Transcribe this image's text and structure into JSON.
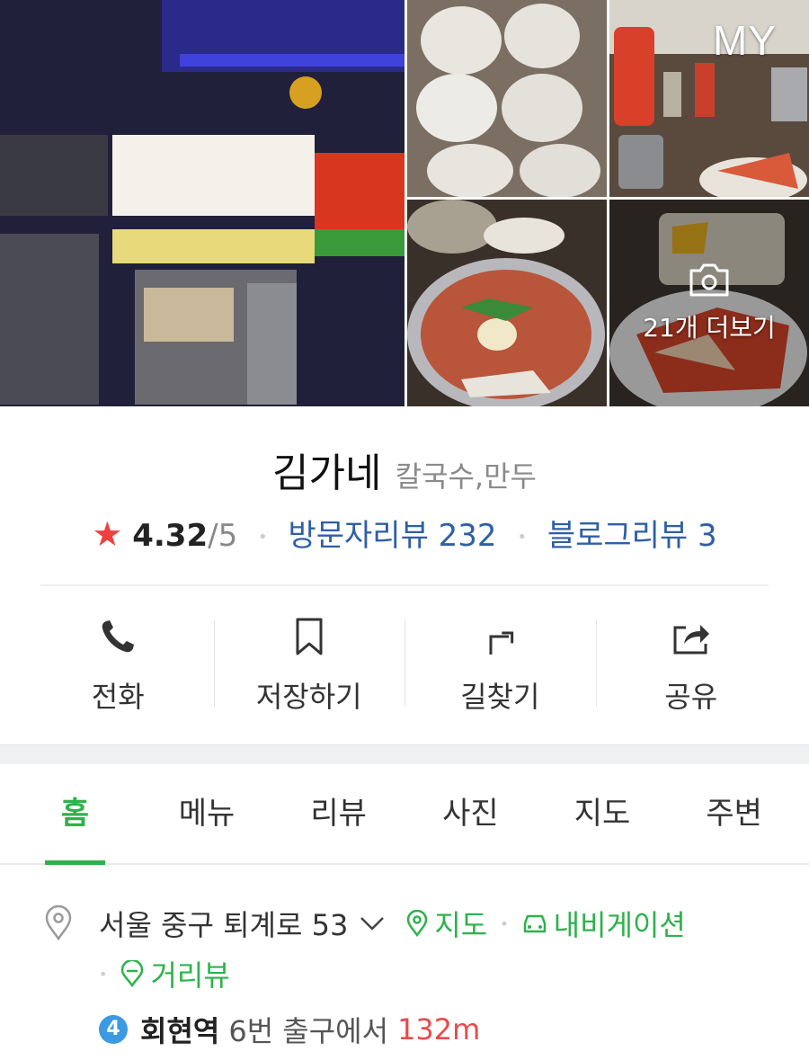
{
  "photos": {
    "my_label": "MY",
    "more_label": "21개 더보기"
  },
  "place": {
    "name": "김가네",
    "category": "칼국수,만두",
    "rating": "4.32",
    "rating_max": "/5",
    "visitor_review": "방문자리뷰 232",
    "blog_review": "블로그리뷰 3"
  },
  "actions": [
    {
      "label": "전화",
      "icon": "phone-icon"
    },
    {
      "label": "저장하기",
      "icon": "bookmark-icon"
    },
    {
      "label": "길찾기",
      "icon": "directions-icon"
    },
    {
      "label": "공유",
      "icon": "share-icon"
    }
  ],
  "tabs": [
    {
      "label": "홈",
      "active": true
    },
    {
      "label": "메뉴"
    },
    {
      "label": "리뷰"
    },
    {
      "label": "사진"
    },
    {
      "label": "지도"
    },
    {
      "label": "주변"
    }
  ],
  "address": {
    "text": "서울 중구 퇴계로 53",
    "map_link": "지도",
    "nav_link": "내비게이션",
    "street_view": "거리뷰",
    "subway_line": "4",
    "station": "회현역",
    "exit": "6번 출구에서",
    "distance": "132m"
  },
  "colors": {
    "accent_green": "#2eb24b",
    "link_blue": "#2e5fa8",
    "star_red": "#ef4040",
    "line4_blue": "#3b9ae1"
  }
}
